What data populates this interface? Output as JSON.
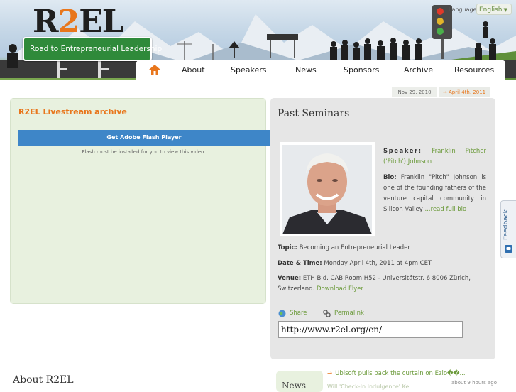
{
  "header": {
    "logo": {
      "part1": "R",
      "accent": "2",
      "part2": "EL"
    },
    "road_sign": "Road to Entrepreneurial Leadership",
    "language_label": "Language",
    "language_selected": "English"
  },
  "nav": {
    "items": [
      {
        "label": "About"
      },
      {
        "label": "Speakers"
      },
      {
        "label": "News"
      },
      {
        "label": "Sponsors"
      },
      {
        "label": "Archive"
      },
      {
        "label": "Resources"
      }
    ]
  },
  "date_tabs": {
    "tab1": "Nov 29. 2010",
    "tab2": "April 4th, 2011",
    "tab2_arrow": "→"
  },
  "livestream": {
    "title": "R2EL Livestream archive",
    "button": "Get Adobe Flash Player",
    "note": "Flash must be installed for you to view this video."
  },
  "seminars": {
    "title": "Past Seminars",
    "speaker_label": "Speaker:",
    "speaker_name": "Franklin Pitcher ('Pitch') Johnson",
    "bio_label": "Bio:",
    "bio_text": "Franklin \"Pitch\" Johnson is one of the founding fathers of the venture capital community in Silicon Valley",
    "bio_link": "...read full bio",
    "topic_label": "Topic:",
    "topic_value": "Becoming an Entrepreneurial Leader",
    "datetime_label": "Date & Time:",
    "datetime_value": "Monday April 4th, 2011 at 4pm CET",
    "venue_label": "Venue:",
    "venue_value": "ETH Bld. CAB Room H52 - Universitätstr. 6 8006 Zürich, Switzerland.",
    "venue_link": "Download Flyer",
    "share": "Share",
    "permalink": "Permalink",
    "url": "http://www.r2el.org/en/"
  },
  "about": {
    "title": "About R2EL"
  },
  "news": {
    "title": "News",
    "item1": "Ubisoft pulls back the curtain on Ezio��...",
    "item1_time": "about 9 hours ago",
    "item2": "Will 'Check-In Indulgence' Ke..."
  },
  "feedback": {
    "label": "Feedback"
  },
  "colors": {
    "accent": "#e8761c",
    "link": "#6b9a3a",
    "panel_green": "#e8f1df",
    "panel_gray": "#e6e6e6",
    "flash_blue": "#3e86c8"
  }
}
